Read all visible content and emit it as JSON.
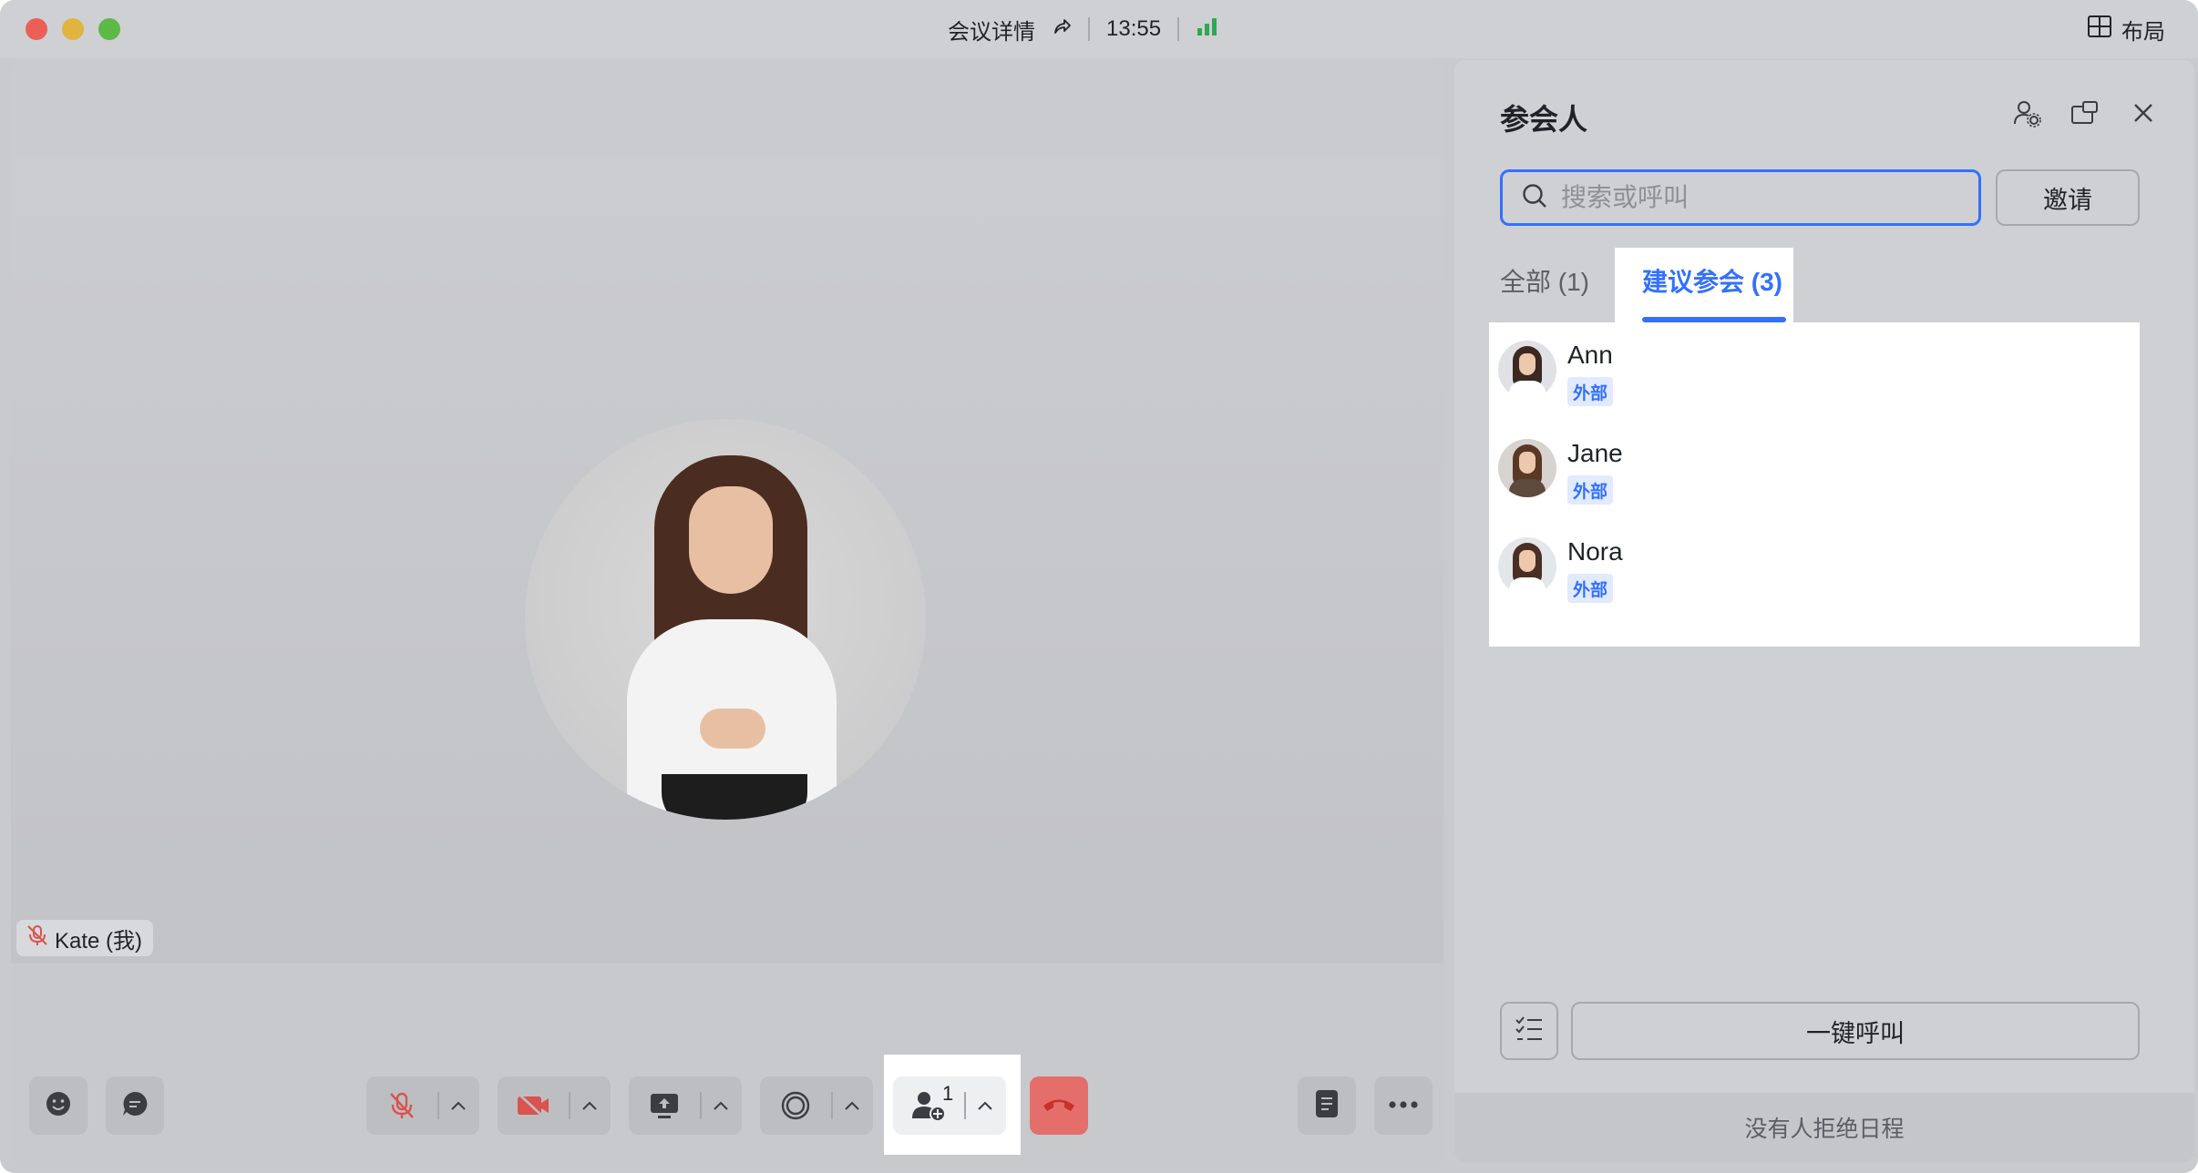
{
  "titlebar": {
    "meeting_details": "会议详情",
    "time": "13:55",
    "layout_label": "布局"
  },
  "stage": {
    "self_name": "Kate (我)"
  },
  "toolbar": {
    "participants_count": "1"
  },
  "panel": {
    "title": "参会人",
    "search_placeholder": "搜索或呼叫",
    "invite_label": "邀请",
    "tabs": {
      "all": "全部 (1)",
      "suggested": "建议参会 (3)"
    },
    "suggested": [
      {
        "name": "Ann",
        "badge": "外部"
      },
      {
        "name": "Jane",
        "badge": "外部"
      },
      {
        "name": "Nora",
        "badge": "外部"
      }
    ],
    "call_all_label": "一键呼叫",
    "footer": "没有人拒绝日程"
  },
  "colors": {
    "accent": "#3370ff",
    "hangup": "#e46e6a",
    "muted_red": "#d9534f",
    "signal_green": "#2fa84f"
  }
}
